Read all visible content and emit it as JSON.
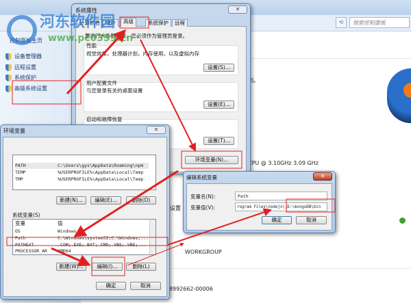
{
  "control_panel": {
    "search_placeholder": "搜索控制面板",
    "sidebar_home": "控制面板主页",
    "sidebar_items": [
      "设备管理器",
      "远程设置",
      "系统保护",
      "高级系统设置"
    ],
    "bg_text": {
      "notice_tail": "利。",
      "cpu": "CPU @ 3.10GHz   3.09 GHz",
      "settings_fragment": "设置",
      "workgroup": "WORKGROUP",
      "product_id": "-8992662-00006"
    }
  },
  "system_properties": {
    "title": "系统属性",
    "tabs": [
      "计算机名",
      "硬件",
      "高级",
      "系统保护",
      "远程"
    ],
    "active_tab": 2,
    "admin_note": "要进行大多数更改，您必须作为管理员登录。",
    "performance": {
      "title": "性能",
      "desc": "视觉效果，处理器计划，内存使用，以及虚拟内存",
      "button": "设置(S)..."
    },
    "user_profiles": {
      "title": "用户配置文件",
      "desc": "与您登录有关的桌面设置",
      "button": "设置(E)..."
    },
    "startup": {
      "title": "启动和故障恢复",
      "button": "设置(T)..."
    },
    "env_button": "环境变量(N)..."
  },
  "env_vars": {
    "title": "环境变量",
    "user_vars": [
      {
        "name": "PATH",
        "value": "C:\\Users\\gys\\AppData\\Roaming\\npm"
      },
      {
        "name": "TEMP",
        "value": "%USERPROFILE%\\AppData\\Local\\Temp"
      },
      {
        "name": "TMP",
        "value": "%USERPROFILE%\\AppData\\Local\\Temp"
      }
    ],
    "user_buttons": [
      "新建(N)...",
      "编辑(E)...",
      "删除(D)"
    ],
    "system_label": "系统变量(S)",
    "col_var": "变量",
    "col_value": "值",
    "system_vars": [
      {
        "name": "OS",
        "value": "Windows_NT"
      },
      {
        "name": "Path",
        "value": "C:\\Windows\\system32;C:\\Windows;..."
      },
      {
        "name": "PATHEXT",
        "value": ".COM;.EXE;.BAT;.CMD;.VBS;.VBE;..."
      },
      {
        "name": "PROCESSOR_AR",
        "value": "AMD64"
      }
    ],
    "system_buttons": [
      "新建(W)...",
      "编辑(I)...",
      "删除(L)"
    ],
    "ok": "确定",
    "cancel": "取消"
  },
  "edit_var": {
    "title": "编辑系统变量",
    "name_label": "变量名(N):",
    "name_value": "Path",
    "value_label": "变量值(V):",
    "value_value": "rogram Files\\nodejs\\;D:\\mongoDB\\bin",
    "ok": "确定",
    "cancel": "取消"
  },
  "watermark": {
    "name": "河东软件园",
    "url": "www.pc0359.cn"
  },
  "annotation_color": "#e02020"
}
